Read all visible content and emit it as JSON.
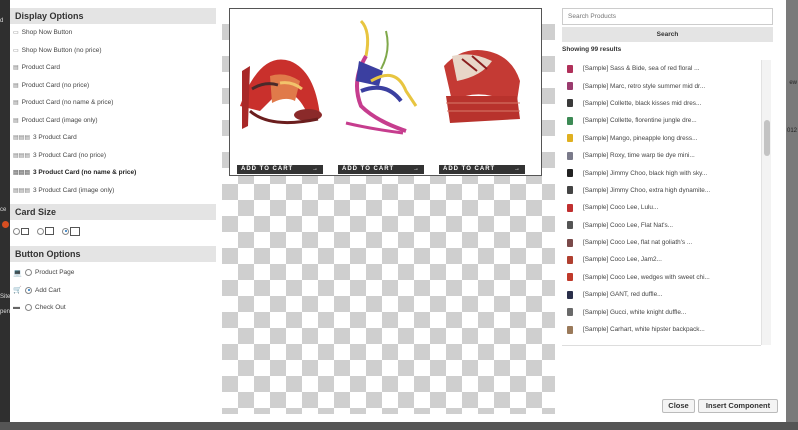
{
  "left_panel": {
    "display_options": {
      "title": "Display Options",
      "items": [
        {
          "label": "Shop Now Button",
          "bold": false,
          "icon": "button-outline-icon"
        },
        {
          "label": "Shop Now Button (no price)",
          "bold": false,
          "icon": "button-outline-icon"
        },
        {
          "label": "Product Card",
          "bold": false,
          "icon": "card-icon"
        },
        {
          "label": "Product Card (no price)",
          "bold": false,
          "icon": "card-icon"
        },
        {
          "label": "Product Card (no name & price)",
          "bold": false,
          "icon": "card-icon"
        },
        {
          "label": "Product Card (image only)",
          "bold": false,
          "icon": "card-icon"
        },
        {
          "label": "3 Product Card",
          "bold": false,
          "icon": "triple-card-icon"
        },
        {
          "label": "3 Product Card (no price)",
          "bold": false,
          "icon": "triple-card-icon"
        },
        {
          "label": "3 Product Card (no name & price)",
          "bold": true,
          "icon": "triple-card-icon"
        },
        {
          "label": "3 Product Card (image only)",
          "bold": false,
          "icon": "triple-card-icon"
        }
      ]
    },
    "card_size": {
      "title": "Card Size",
      "options": [
        {
          "size": "small",
          "selected": false
        },
        {
          "size": "medium",
          "selected": false
        },
        {
          "size": "large",
          "selected": true
        }
      ]
    },
    "button_options": {
      "title": "Button Options",
      "items": [
        {
          "label": "Product Page",
          "icon": "laptop-icon",
          "selected": false
        },
        {
          "label": "Add Cart",
          "icon": "cart-icon",
          "selected": true
        },
        {
          "label": "Check Out",
          "icon": "card-payment-icon",
          "selected": false
        }
      ]
    }
  },
  "preview": {
    "products": [
      {
        "button_label": "ADD TO CART",
        "arrow": "→"
      },
      {
        "button_label": "ADD TO CART",
        "arrow": "→"
      },
      {
        "button_label": "ADD TO CART",
        "arrow": "→"
      }
    ]
  },
  "right_panel": {
    "search_placeholder": "Search Products",
    "search_button": "Search",
    "results_count": "Showing 99 results",
    "results": [
      {
        "label": "[Sample] Sass & Bide, sea of red floral ...",
        "color": "#b0305a"
      },
      {
        "label": "[Sample] Marc, retro style summer mid dr...",
        "color": "#9a3b6e"
      },
      {
        "label": "[Sample] Collette, black kisses mid dres...",
        "color": "#3a3a3a"
      },
      {
        "label": "[Sample] Collette, florentine jungle dre...",
        "color": "#3d8a55"
      },
      {
        "label": "[Sample] Mango, pineapple long dress...",
        "color": "#e0b020"
      },
      {
        "label": "[Sample] Roxy, time warp tie dye mini...",
        "color": "#7a7a8a"
      },
      {
        "label": "[Sample] Jimmy Choo, black high with sky...",
        "color": "#222222"
      },
      {
        "label": "[Sample] Jimmy Choo, extra high dynamite...",
        "color": "#444444"
      },
      {
        "label": "[Sample] Coco Lee, Lulu...",
        "color": "#c03030"
      },
      {
        "label": "[Sample] Coco Lee, Flat Nat's...",
        "color": "#555555"
      },
      {
        "label": "[Sample] Coco Lee, flat nat goliath's ...",
        "color": "#7a4a4a"
      },
      {
        "label": "[Sample] Coco Lee, Jam2...",
        "color": "#b04030"
      },
      {
        "label": "[Sample] Coco Lee, wedges with sweet chi...",
        "color": "#c03a2a"
      },
      {
        "label": "[Sample] GANT, red duffle...",
        "color": "#2a2f4a"
      },
      {
        "label": "[Sample] Gucci, white knight duffle...",
        "color": "#6a6a6a"
      },
      {
        "label": "[Sample] Carhart, white hipster backpack...",
        "color": "#9a7a5a"
      }
    ]
  },
  "footer": {
    "close_label": "Close",
    "insert_label": "Insert Component"
  },
  "background": {
    "left_fragments": [
      "d",
      "ce",
      "Site",
      "pen"
    ],
    "right_fragments": [
      "ew",
      "012"
    ]
  }
}
